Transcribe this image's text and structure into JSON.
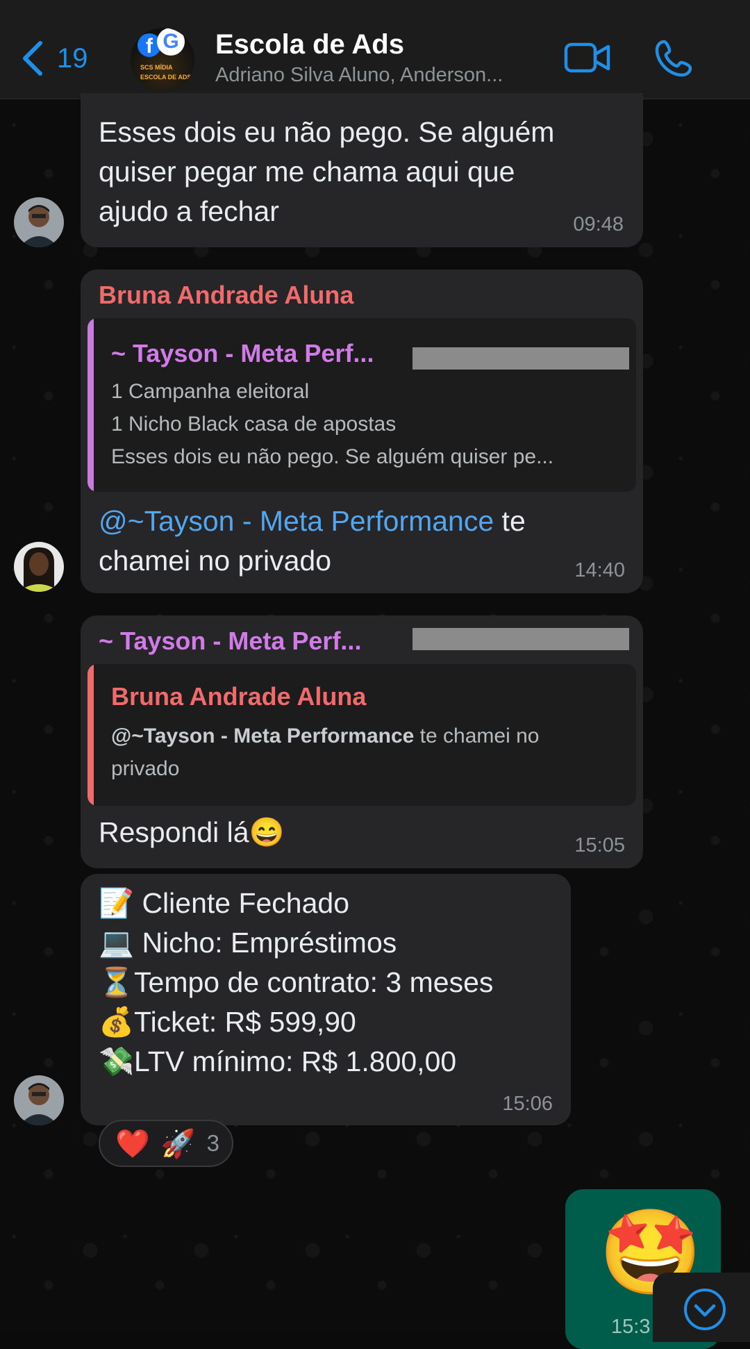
{
  "header": {
    "back_count": "19",
    "title": "Escola de Ads",
    "subtitle": "Adriano Silva Aluno, Anderson...",
    "avatar_tag1": "SCS MÍDIA",
    "avatar_tag2": "ESCOLA DE ADS"
  },
  "messages": {
    "m1": {
      "lines": [
        "Esses dois eu não pego. Se alguém",
        "quiser pegar me chama aqui que",
        "ajudo a fechar"
      ],
      "time": "09:48"
    },
    "m2": {
      "sender": "Bruna Andrade Aluna",
      "quote_sender": "~ Tayson - Meta Perf...",
      "quote_lines": [
        "1 Campanha eleitoral",
        "1 Nicho Black casa de apostas",
        "Esses dois eu não pego. Se alguém quiser pe..."
      ],
      "mention": "@~Tayson - Meta Performance",
      "text_rest": " te",
      "line2": "chamei no privado",
      "time": "14:40"
    },
    "m3": {
      "sender": "~ Tayson - Meta Perf...",
      "quote_sender": "Bruna Andrade Aluna",
      "quote_mention": "@~Tayson - Meta Performance",
      "quote_rest": " te chamei no",
      "quote_line2": "privado",
      "text": "Respondi lá😄",
      "time": "15:05"
    },
    "m4": {
      "lines": [
        "📝 Cliente Fechado",
        "💻 Nicho: Empréstimos",
        "⏳Tempo de contrato: 3 meses",
        "💰Ticket: R$ 599,90",
        "💸LTV mínimo: R$ 1.800,00"
      ],
      "time": "15:06",
      "reactions": {
        "emoji1": "❤️",
        "emoji2": "🚀",
        "count": "3"
      }
    },
    "m5": {
      "sticker": "🤩",
      "time": "15:3"
    }
  },
  "colors": {
    "accent": "#1f8fe8",
    "sender_bruna": "#f06b6b",
    "sender_tayson": "#d17be8",
    "quote_bar_tayson": "#c67ddb",
    "quote_bar_bruna": "#ef6c6c",
    "mention": "#53a6f0",
    "outgoing_bubble": "#005c4b"
  },
  "icons": [
    "chevron-left-icon",
    "video-camera-icon",
    "phone-icon",
    "chevron-down-icon"
  ]
}
